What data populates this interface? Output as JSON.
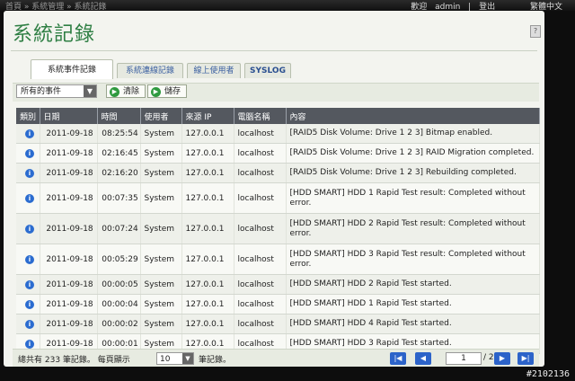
{
  "header": {
    "breadcrumb": "首頁 » 系統管理 » 系統記錄",
    "welcome": "歡迎",
    "user": "admin",
    "separator": "|",
    "logout": "登出",
    "language": "繁體中文"
  },
  "page": {
    "title": "系統記錄",
    "tabs": [
      {
        "label": "系統事件記錄",
        "active": true
      },
      {
        "label": "系統連線記錄",
        "active": false
      },
      {
        "label": "線上使用者",
        "active": false
      },
      {
        "label": "SYSLOG",
        "active": false
      }
    ]
  },
  "toolbar": {
    "filter_value": "所有的事件",
    "clear_label": "清除",
    "save_label": "儲存"
  },
  "table": {
    "columns": [
      "類別",
      "日期",
      "時間",
      "使用者",
      "來源 IP",
      "電腦名稱",
      "內容"
    ],
    "rows": [
      {
        "date": "2011-09-18",
        "time": "08:25:54",
        "user": "System",
        "ip": "127.0.0.1",
        "host": "localhost",
        "content": "[RAID5 Disk Volume: Drive 1 2 3] Bitmap enabled."
      },
      {
        "date": "2011-09-18",
        "time": "02:16:45",
        "user": "System",
        "ip": "127.0.0.1",
        "host": "localhost",
        "content": "[RAID5 Disk Volume: Drive 1 2 3] RAID Migration completed."
      },
      {
        "date": "2011-09-18",
        "time": "02:16:20",
        "user": "System",
        "ip": "127.0.0.1",
        "host": "localhost",
        "content": "[RAID5 Disk Volume: Drive 1 2 3] Rebuilding completed."
      },
      {
        "date": "2011-09-18",
        "time": "00:07:35",
        "user": "System",
        "ip": "127.0.0.1",
        "host": "localhost",
        "content": "[HDD SMART] HDD 1 Rapid Test result: Completed without error."
      },
      {
        "date": "2011-09-18",
        "time": "00:07:24",
        "user": "System",
        "ip": "127.0.0.1",
        "host": "localhost",
        "content": "[HDD SMART] HDD 2 Rapid Test result: Completed without error."
      },
      {
        "date": "2011-09-18",
        "time": "00:05:29",
        "user": "System",
        "ip": "127.0.0.1",
        "host": "localhost",
        "content": "[HDD SMART] HDD 3 Rapid Test result: Completed without error."
      },
      {
        "date": "2011-09-18",
        "time": "00:00:05",
        "user": "System",
        "ip": "127.0.0.1",
        "host": "localhost",
        "content": "[HDD SMART] HDD 2 Rapid Test started."
      },
      {
        "date": "2011-09-18",
        "time": "00:00:04",
        "user": "System",
        "ip": "127.0.0.1",
        "host": "localhost",
        "content": "[HDD SMART] HDD 1 Rapid Test started."
      },
      {
        "date": "2011-09-18",
        "time": "00:00:02",
        "user": "System",
        "ip": "127.0.0.1",
        "host": "localhost",
        "content": "[HDD SMART] HDD 4 Rapid Test started."
      },
      {
        "date": "2011-09-18",
        "time": "00:00:01",
        "user": "System",
        "ip": "127.0.0.1",
        "host": "localhost",
        "content": "[HDD SMART] HDD 3 Rapid Test started."
      }
    ]
  },
  "pagination": {
    "summary": "總共有 233 筆記錄。 每頁顯示",
    "per_page": "10",
    "per_page_suffix": "筆記錄。",
    "current_page": "1",
    "total_pages": "/ 24"
  },
  "watermark": "#2102136",
  "colors": {
    "accent": "#2f7f44",
    "header_row": "#54585f",
    "info_icon": "#2b6cd0",
    "pager_button": "#2c63c9"
  }
}
